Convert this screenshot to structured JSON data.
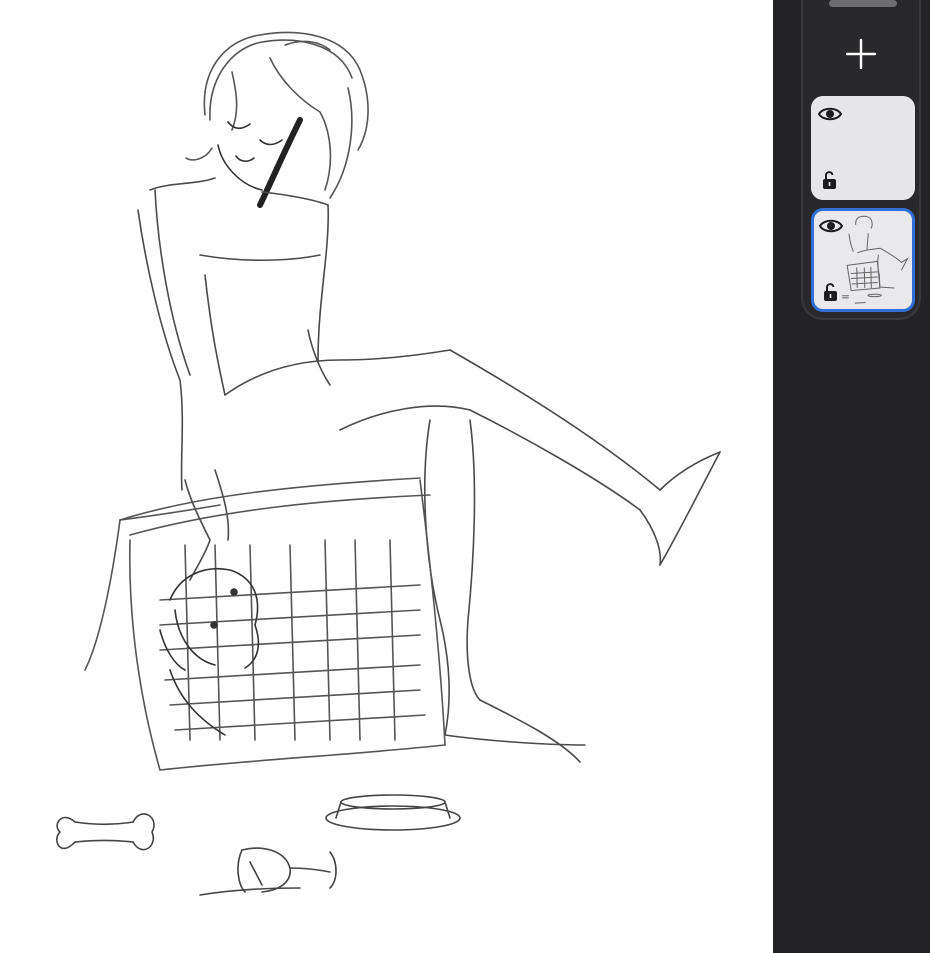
{
  "canvas": {
    "background": "#ffffff",
    "stroke_color": "#4a4a4a"
  },
  "sidebar": {
    "background": "#232325",
    "add_layer_icon": "plus-icon",
    "selected_color": "#2f6fd6",
    "layers": [
      {
        "name": "",
        "visible_icon": "eye-icon",
        "lock_icon": "unlocked-padlock-icon",
        "selected": false,
        "has_content": false
      },
      {
        "name": "",
        "visible_icon": "eye-icon",
        "lock_icon": "unlocked-padlock-icon",
        "selected": true,
        "has_content": true
      }
    ]
  }
}
